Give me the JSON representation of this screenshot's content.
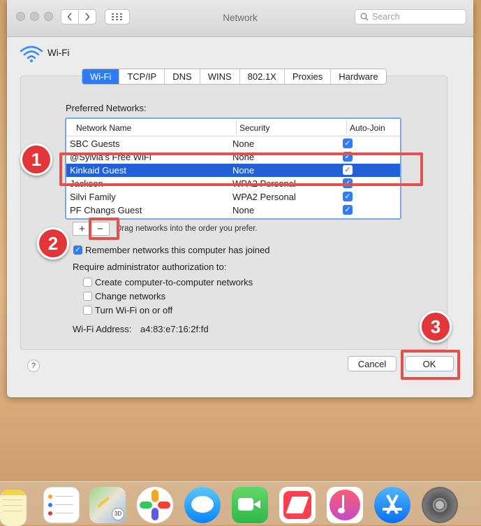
{
  "window": {
    "title": "Network",
    "search_placeholder": "Search",
    "back_icon": "chevron-left-icon",
    "forward_icon": "chevron-right-icon",
    "grid_icon": "grid-icon"
  },
  "header": {
    "label": "Wi-Fi",
    "icon": "wifi-icon"
  },
  "tabs": [
    "Wi-Fi",
    "TCP/IP",
    "DNS",
    "WINS",
    "802.1X",
    "Proxies",
    "Hardware"
  ],
  "active_tab": "Wi-Fi",
  "preferred": {
    "label": "Preferred Networks:",
    "columns": [
      "Network Name",
      "Security",
      "Auto-Join"
    ],
    "rows": [
      {
        "name": "SBC Guests",
        "security": "None",
        "auto_join": true
      },
      {
        "name": "@Sylvia's Free WiFi",
        "security": "None",
        "auto_join": true
      },
      {
        "name": "Kinkaid Guest",
        "security": "None",
        "auto_join": true,
        "selected": true
      },
      {
        "name": "Jackson",
        "security": "WPA2 Personal",
        "auto_join": true
      },
      {
        "name": "Silvi Family",
        "security": "WPA2 Personal",
        "auto_join": true
      },
      {
        "name": "PF Changs Guest",
        "security": "None",
        "auto_join": true
      }
    ],
    "add_label": "+",
    "remove_label": "−",
    "drag_hint": "Drag networks into the order you prefer."
  },
  "options": {
    "remember": {
      "label": "Remember networks this computer has joined",
      "checked": true
    },
    "require_label": "Require administrator authorization to:",
    "admin": [
      {
        "label": "Create computer-to-computer networks",
        "checked": false
      },
      {
        "label": "Change networks",
        "checked": false
      },
      {
        "label": "Turn Wi-Fi on or off",
        "checked": false
      }
    ],
    "address_label": "Wi-Fi Address:",
    "address_value": "a4:83:e7:16:2f:fd"
  },
  "footer": {
    "help": "?",
    "cancel": "Cancel",
    "ok": "OK"
  },
  "callouts": [
    "1",
    "2",
    "3"
  ],
  "colors": {
    "accent": "#2f7cf6",
    "selection": "#2160d9",
    "callout": "#e2363a"
  },
  "dock": [
    "notes-icon",
    "reminders-icon",
    "maps-icon",
    "photos-icon",
    "messages-icon",
    "facetime-icon",
    "news-icon",
    "music-icon",
    "app-store-icon",
    "system-preferences-icon"
  ]
}
